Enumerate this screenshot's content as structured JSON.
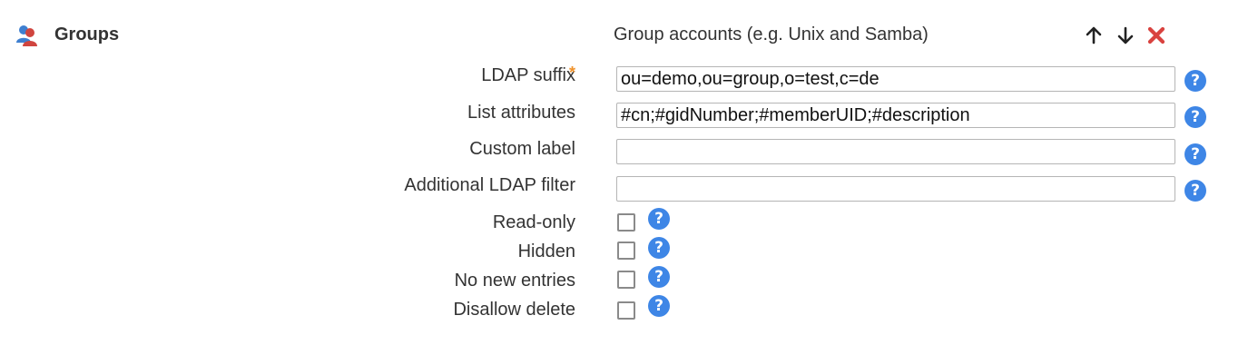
{
  "section": {
    "title": "Groups",
    "type_description": "Group accounts (e.g. Unix and Samba)",
    "icons": {
      "section": "groups-icon",
      "move_up": "arrow-up-icon",
      "move_down": "arrow-down-icon",
      "remove": "close-icon"
    }
  },
  "fields": {
    "ldap_suffix": {
      "label": "LDAP suffix",
      "required_marker": "*",
      "value": "ou=demo,ou=group,o=test,c=de"
    },
    "list_attributes": {
      "label": "List attributes",
      "value": "#cn;#gidNumber;#memberUID;#description"
    },
    "custom_label": {
      "label": "Custom label",
      "value": ""
    },
    "additional_filter": {
      "label": "Additional LDAP filter",
      "value": ""
    }
  },
  "options": {
    "read_only": {
      "label": "Read-only",
      "checked": false
    },
    "hidden": {
      "label": "Hidden",
      "checked": false
    },
    "no_new_entries": {
      "label": "No new entries",
      "checked": false
    },
    "disallow_delete": {
      "label": "Disallow delete",
      "checked": false
    }
  },
  "help_symbol": "?",
  "colors": {
    "help": "#3e86e6",
    "required": "#f0922a",
    "remove": "#d9423f",
    "text": "#333333"
  }
}
